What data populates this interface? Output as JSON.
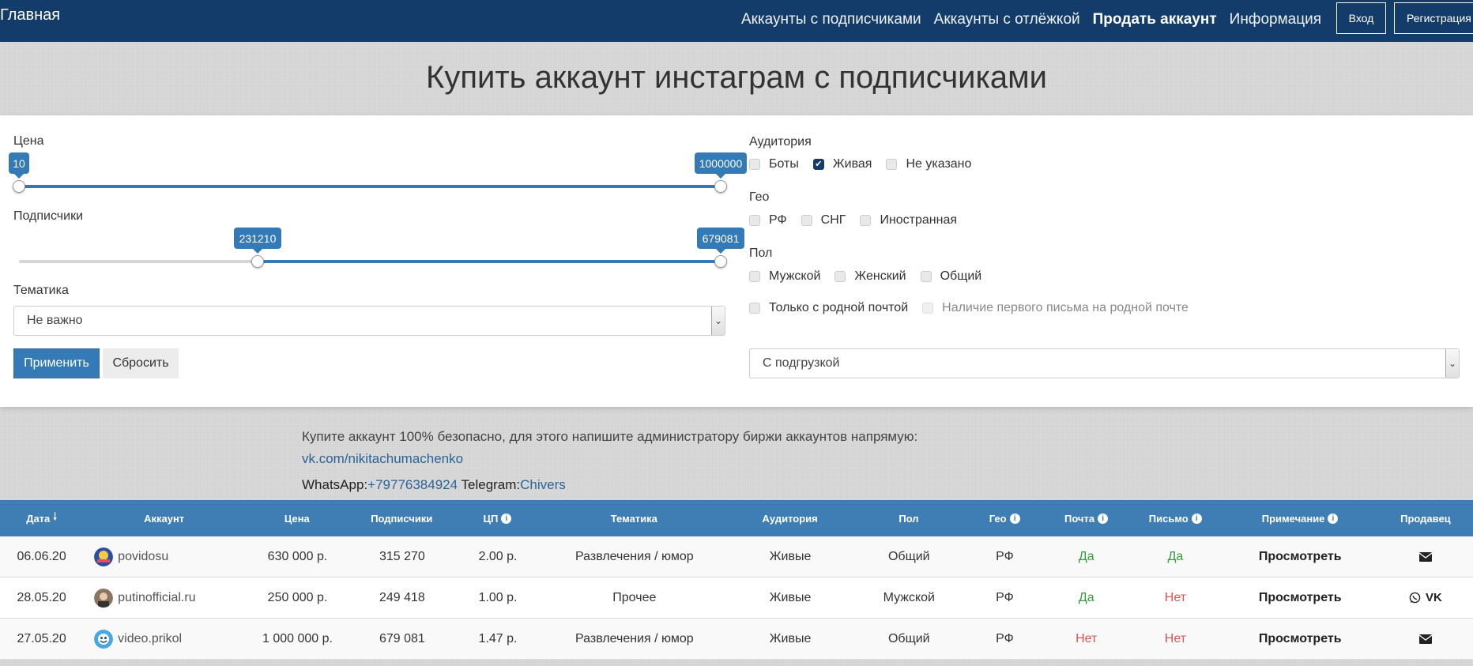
{
  "nav": {
    "brand": "Главная",
    "links": [
      "Аккаунты с подписчиками",
      "Аккаунты с отлёжкой",
      "Продать аккаунт",
      "Информация"
    ],
    "login": "Вход",
    "register": "Регистрация"
  },
  "title": "Купить аккаунт инстаграм с подписчиками",
  "filters": {
    "price": {
      "label": "Цена",
      "min": "10",
      "max": "1000000"
    },
    "subscribers": {
      "label": "Подписчики",
      "min": "231210",
      "max": "679081"
    },
    "topic": {
      "label": "Тематика",
      "value": "Не важно"
    },
    "apply": "Применить",
    "reset": "Сбросить",
    "audience": {
      "label": "Аудитория",
      "options": [
        {
          "text": "Боты",
          "checked": false
        },
        {
          "text": "Живая",
          "checked": true
        },
        {
          "text": "Не указано",
          "checked": false
        }
      ]
    },
    "geo": {
      "label": "Гео",
      "options": [
        {
          "text": "РФ",
          "checked": false
        },
        {
          "text": "СНГ",
          "checked": false
        },
        {
          "text": "Иностранная",
          "checked": false
        }
      ]
    },
    "gender": {
      "label": "Пол",
      "options": [
        {
          "text": "Мужской",
          "checked": false
        },
        {
          "text": "Женский",
          "checked": false
        },
        {
          "text": "Общий",
          "checked": false
        }
      ]
    },
    "native_mail": "Только с родной почтой",
    "first_letter": "Наличие первого письма на родной почте",
    "loading": "С подгрузкой"
  },
  "info": {
    "line1": "Купите аккаунт 100% безопасно, для этого напишите администратору биржи аккаунтов напрямую:",
    "vk": "vk.com/nikitachumachenko",
    "whatsapp_label": "WhatsApp:",
    "whatsapp": "+79776384924",
    "telegram_label": " Telegram:",
    "telegram": "Chivers"
  },
  "table": {
    "headers": {
      "date": "Дата",
      "account": "Аккаунт",
      "price": "Цена",
      "subs": "Подписчики",
      "cp": "ЦП",
      "topic": "Тематика",
      "audience": "Аудитория",
      "gender": "Пол",
      "geo": "Гео",
      "mail": "Почта",
      "letter": "Письмо",
      "note": "Примечание",
      "seller": "Продавец"
    },
    "rows": [
      {
        "date": "06.06.20",
        "account": "povidosu",
        "price": "630 000 р.",
        "subs": "315 270",
        "cp": "2.00 р.",
        "topic": "Развлечения / юмор",
        "audience": "Живые",
        "gender": "Общий",
        "geo": "РФ",
        "mail": "Да",
        "letter": "Да",
        "note": "Просмотреть"
      },
      {
        "date": "28.05.20",
        "account": "putinofficial.ru",
        "price": "250 000 р.",
        "subs": "249 418",
        "cp": "1.00 р.",
        "topic": "Прочее",
        "audience": "Живые",
        "gender": "Мужской",
        "geo": "РФ",
        "mail": "Да",
        "letter": "Нет",
        "note": "Просмотреть"
      },
      {
        "date": "27.05.20",
        "account": "video.prikol",
        "price": "1 000 000 р.",
        "subs": "679 081",
        "cp": "1.47 р.",
        "topic": "Развлечения / юмор",
        "audience": "Живые",
        "gender": "Общий",
        "geo": "РФ",
        "mail": "Нет",
        "letter": "Нет",
        "note": "Просмотреть"
      }
    ]
  }
}
